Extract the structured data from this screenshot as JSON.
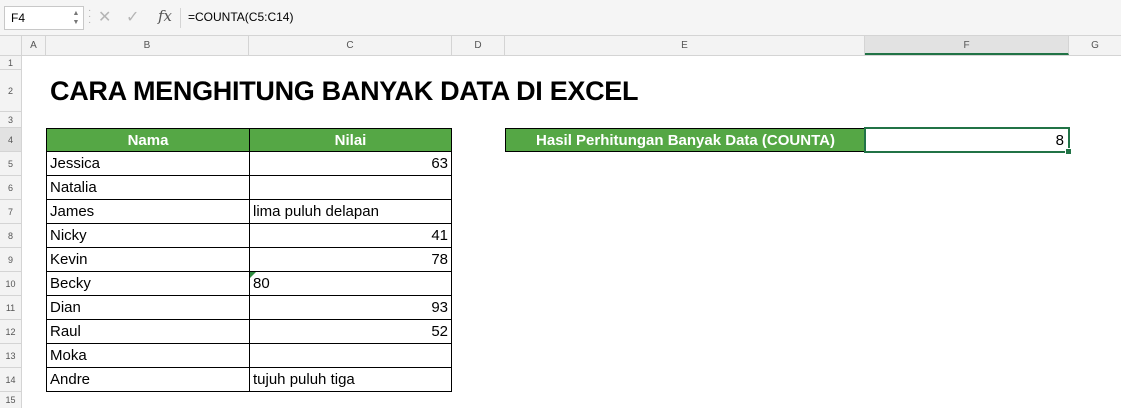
{
  "formula_bar": {
    "name_box": "F4",
    "formula": "=COUNTA(C5:C14)",
    "fx_label": "fx",
    "cancel_icon": "x-icon",
    "confirm_icon": "check-icon"
  },
  "columns": [
    "A",
    "B",
    "C",
    "D",
    "E",
    "F",
    "G"
  ],
  "rows": [
    "1",
    "2",
    "3",
    "4",
    "5",
    "6",
    "7",
    "8",
    "9",
    "10",
    "11",
    "12",
    "13",
    "14",
    "15"
  ],
  "selected_cell": {
    "column": "F",
    "row": "4"
  },
  "sheet": {
    "title": "CARA MENGHITUNG BANYAK DATA DI EXCEL",
    "table": {
      "headers": [
        "Nama",
        "Nilai"
      ],
      "rows": [
        {
          "nama": "Jessica",
          "nilai": "63"
        },
        {
          "nama": "Natalia",
          "nilai": ""
        },
        {
          "nama": "James",
          "nilai": "lima puluh delapan"
        },
        {
          "nama": "Nicky",
          "nilai": "41"
        },
        {
          "nama": "Kevin",
          "nilai": "78"
        },
        {
          "nama": "Becky",
          "nilai": "80"
        },
        {
          "nama": "Dian",
          "nilai": "93"
        },
        {
          "nama": "Raul",
          "nilai": "52"
        },
        {
          "nama": "Moka",
          "nilai": ""
        },
        {
          "nama": "Andre",
          "nilai": "tujuh puluh tiga"
        }
      ]
    },
    "result": {
      "label": "Hasil Perhitungan Banyak Data (COUNTA)",
      "value": "8"
    }
  },
  "colors": {
    "header_green": "#55a745",
    "selection_green": "#217346",
    "error_indicator": "#2e8b3e"
  }
}
